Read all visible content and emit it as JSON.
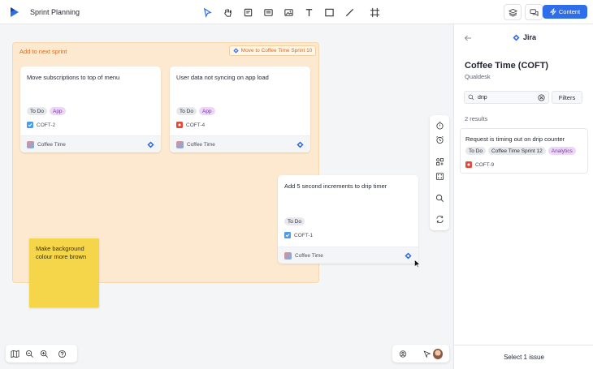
{
  "app": {
    "title": "Sprint Planning"
  },
  "toolbar": {
    "tools": [
      "cursor-icon",
      "hand-icon",
      "sticky-note-icon",
      "card-icon",
      "image-icon",
      "text-icon",
      "rectangle-icon",
      "line-icon",
      "frame-icon"
    ],
    "content_label": "Content"
  },
  "frame": {
    "title": "Add to next sprint",
    "move_label": "Move to Coffee Time Sprint 10"
  },
  "cards": [
    {
      "title": "Move subscriptions to top of menu",
      "status": "To Do",
      "label": "App",
      "issue_type": "task",
      "key": "COFT-2",
      "project": "Coffee Time"
    },
    {
      "title": "User data not syncing on app load",
      "status": "To Do",
      "label": "App",
      "issue_type": "bug",
      "key": "COFT-4",
      "project": "Coffee Time"
    },
    {
      "title": "Add 5 second increments to drip timer",
      "status": "To Do",
      "issue_type": "task",
      "key": "COFT-1",
      "project": "Coffee Time"
    }
  ],
  "sticky": {
    "text": "Make background colour more brown"
  },
  "panel": {
    "header": "Jira",
    "project_title": "Coffee Time (COFT)",
    "project_sub": "Qualdesk",
    "search_value": "drip",
    "filters_label": "Filters",
    "results_count": "2 results",
    "result": {
      "title": "Request is timing out on drip counter",
      "status": "To Do",
      "sprint": "Coffee Time Sprint 12",
      "label": "Analytics",
      "key": "COFT-9"
    },
    "footer": "Select 1 issue"
  },
  "colors": {
    "accent": "#2f6ee8",
    "frame_bg": "#fde9cf",
    "frame_text": "#d9691b",
    "sticky": "#f5d64a",
    "bug": "#e5493a",
    "task": "#4c9bea"
  }
}
